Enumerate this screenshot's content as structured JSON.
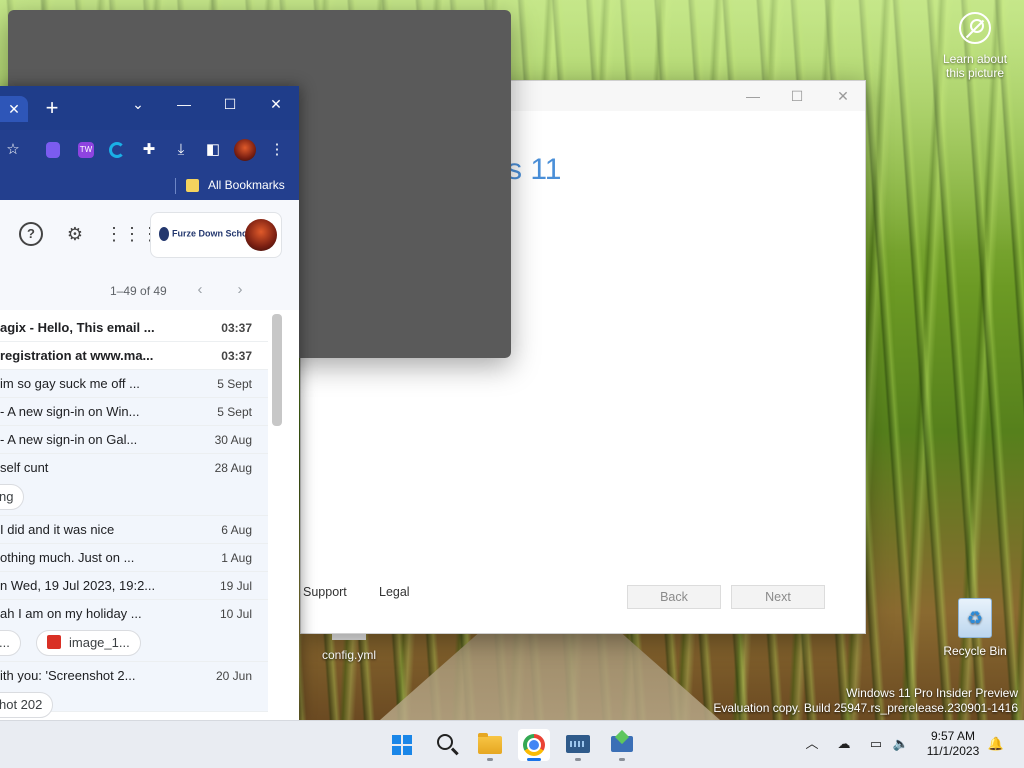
{
  "desktop": {
    "learn_label": "Learn about this picture",
    "recycle_bin_label": "Recycle Bin",
    "file_icon_label": "config.yml",
    "watermark_line1": "Windows 11 Pro Insider Preview",
    "watermark_line2": "Evaluation copy. Build 25947.rs_prerelease.230901-1416"
  },
  "setup_window": {
    "heading_fragment": "s 11",
    "support_label": "Support",
    "legal_label": "Legal",
    "back_label": "Back",
    "next_label": "Next"
  },
  "chrome": {
    "tab_close": "✕",
    "new_tab": "+",
    "tab_search": "⌄",
    "minimize": "—",
    "maximize": "☐",
    "close": "✕",
    "bookmark_star": "☆",
    "ext_tw_label": "TW",
    "bookmarks_label": "All Bookmarks"
  },
  "gmail": {
    "account_logo_text": "Furze Down School",
    "pagination": "1–49 of 49",
    "prev": "‹",
    "next": "›",
    "emails": [
      {
        "snippet": "agix - Hello, This email ...",
        "time": "03:37",
        "bold": true
      },
      {
        "snippet": "registration at www.ma...",
        "time": "03:37",
        "bold": true
      },
      {
        "snippet": "im so gay suck me off ...",
        "time": "5 Sept",
        "bold": false
      },
      {
        "snippet": "- A new sign-in on Win...",
        "time": "5 Sept",
        "bold": false
      },
      {
        "snippet": "- A new sign-in on Gal...",
        "time": "30 Aug",
        "bold": false
      },
      {
        "snippet": "self cunt",
        "time": "28 Aug",
        "bold": false
      },
      {
        "snippet": "I did and it was nice",
        "time": "6 Aug",
        "bold": false
      },
      {
        "snippet": "othing much. Just on ...",
        "time": "1 Aug",
        "bold": false
      },
      {
        "snippet": "n Wed, 19 Jul 2023, 19:2...",
        "time": "19 Jul",
        "bold": false
      },
      {
        "snippet": "ah I am on my holiday ...",
        "time": "10 Jul",
        "bold": false
      },
      {
        "snippet": "ith you: 'Screenshot 2...",
        "time": "20 Jun",
        "bold": false
      }
    ],
    "chip_ng": "ng",
    "chip_dots": "...",
    "chip_image": "image_1...",
    "chip_bottom": "hot 202"
  },
  "taskbar": {
    "clock_time": "9:57 AM",
    "clock_date": "11/1/2023"
  }
}
